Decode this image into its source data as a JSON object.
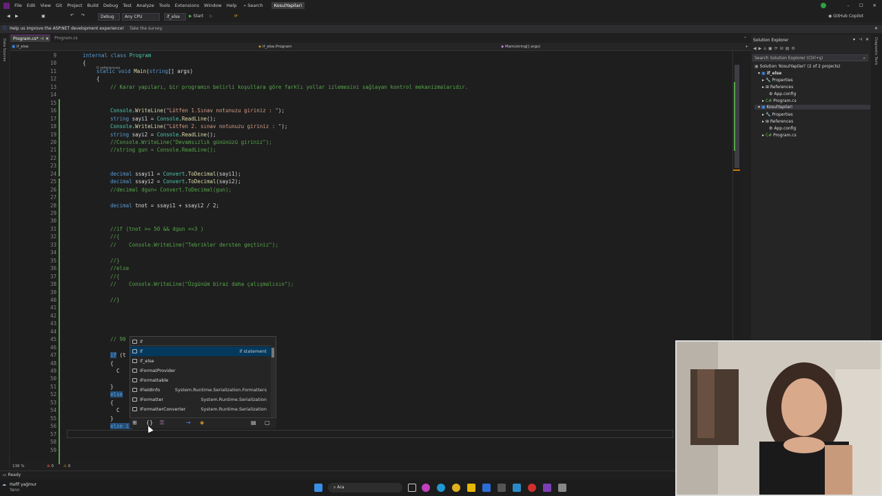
{
  "menu": {
    "items": [
      "File",
      "Edit",
      "View",
      "Git",
      "Project",
      "Build",
      "Debug",
      "Test",
      "Analyze",
      "Tools",
      "Extensions",
      "Window",
      "Help"
    ],
    "search_label": "Search",
    "solution_name": "KosulYapilari"
  },
  "toolbar": {
    "config": "Debug",
    "platform": "Any CPU",
    "project": "if_else",
    "start_label": "Start",
    "copilot_label": "GitHub Copilot"
  },
  "infobar": {
    "message": "Help us improve the ASP.NET development experience!",
    "link": "Take the survey."
  },
  "tabs": {
    "active": "Program.cs*",
    "inactive": "Program.cs",
    "project_dropdown": "if_else"
  },
  "navbar": {
    "class_path": "if_else.Program",
    "method_path": "Main(string[] args)"
  },
  "editor": {
    "references_hint": "0 references",
    "lines": [
      {
        "n": "9",
        "html": "<span class='kw'>internal class</span> <span class='typ'>Program</span>",
        "indent": 0
      },
      {
        "n": "10",
        "html": "<span class='plain'>{</span>",
        "indent": 0
      },
      {
        "n": "11",
        "html": "<span class='kw'>static void</span> <span class='mth'>Main</span><span class='plain'>(</span><span class='kw'>string</span><span class='plain'>[] args)</span>",
        "indent": 1
      },
      {
        "n": "12",
        "html": "<span class='plain'>{</span>",
        "indent": 1
      },
      {
        "n": "13",
        "html": "<span class='cmt'>// Karar yapıları, bir programın belirli koşullara göre farklı yollar izlemesini sağlayan kontrol mekanizmalarıdır.</span>",
        "indent": 2
      },
      {
        "n": "14",
        "html": "",
        "indent": 2
      },
      {
        "n": "15",
        "html": "",
        "indent": 2
      },
      {
        "n": "16",
        "html": "<span class='typ'>Console</span><span class='plain'>.</span><span class='mth'>WriteLine</span><span class='plain'>(</span><span class='str'>\"Lütfen 1.Sınav notunuzu giriniz : \"</span><span class='plain'>);</span>",
        "indent": 2
      },
      {
        "n": "17",
        "html": "<span class='kw'>string</span> <span class='plain'>sayi1 = </span><span class='typ'>Console</span><span class='plain'>.</span><span class='mth'>ReadLine</span><span class='plain'>();</span>",
        "indent": 2
      },
      {
        "n": "18",
        "html": "<span class='typ'>Console</span><span class='plain'>.</span><span class='mth'>WriteLine</span><span class='plain'>(</span><span class='str'>\"Lütfen 2. sınav notunuzu giriniz : \"</span><span class='plain'>);</span>",
        "indent": 2
      },
      {
        "n": "19",
        "html": "<span class='kw'>string</span> <span class='plain'>sayi2 = </span><span class='typ'>Console</span><span class='plain'>.</span><span class='mth'>ReadLine</span><span class='plain'>();</span>",
        "indent": 2
      },
      {
        "n": "20",
        "html": "<span class='cmt'>//Console.WriteLine(\"Devamsızlık gününüzü giriniz\");</span>",
        "indent": 2
      },
      {
        "n": "21",
        "html": "<span class='cmt'>//string gun = Console.ReadLine();</span>",
        "indent": 2
      },
      {
        "n": "22",
        "html": "",
        "indent": 2
      },
      {
        "n": "23",
        "html": "",
        "indent": 2
      },
      {
        "n": "24",
        "html": "<span class='kw'>decimal</span> <span class='plain'>ssayi1 = </span><span class='typ'>Convert</span><span class='plain'>.</span><span class='mth'>ToDecimal</span><span class='plain'>(sayi1);</span>",
        "indent": 2
      },
      {
        "n": "25",
        "html": "<span class='kw'>decimal</span> <span class='plain'>ssayi2 = </span><span class='typ'>Convert</span><span class='plain'>.</span><span class='mth'>ToDecimal</span><span class='plain'>(sayi2);</span>",
        "indent": 2
      },
      {
        "n": "26",
        "html": "<span class='cmt'>//decimal dgun= Convert.ToDecimal(gun);</span>",
        "indent": 2
      },
      {
        "n": "27",
        "html": "",
        "indent": 2
      },
      {
        "n": "28",
        "html": "<span class='kw'>decimal</span> <span class='plain'>tnot = ssayi1 + ssayi2 / 2;</span>",
        "indent": 2
      },
      {
        "n": "29",
        "html": "",
        "indent": 2
      },
      {
        "n": "30",
        "html": "",
        "indent": 2
      },
      {
        "n": "31",
        "html": "<span class='cmt'>//if (tnot &gt;= 50 &amp;&amp; dgun &lt;=3 )</span>",
        "indent": 2
      },
      {
        "n": "32",
        "html": "<span class='cmt'>//{</span>",
        "indent": 2
      },
      {
        "n": "33",
        "html": "<span class='cmt'>//    Console.WriteLine(\"Tebrikler dersten geçtiniz\");</span>",
        "indent": 2
      },
      {
        "n": "34",
        "html": "",
        "indent": 2
      },
      {
        "n": "35",
        "html": "<span class='cmt'>//}</span>",
        "indent": 2
      },
      {
        "n": "36",
        "html": "<span class='cmt'>//else</span>",
        "indent": 2
      },
      {
        "n": "37",
        "html": "<span class='cmt'>//{</span>",
        "indent": 2
      },
      {
        "n": "38",
        "html": "<span class='cmt'>//    Console.WriteLine(\"Üzgünüm biraz daha çalışmalısın\");</span>",
        "indent": 2
      },
      {
        "n": "39",
        "html": "",
        "indent": 2
      },
      {
        "n": "40",
        "html": "<span class='cmt'>//}</span>",
        "indent": 2
      },
      {
        "n": "41",
        "html": "",
        "indent": 2
      },
      {
        "n": "42",
        "html": "",
        "indent": 2
      },
      {
        "n": "43",
        "html": "",
        "indent": 2
      },
      {
        "n": "44",
        "html": "",
        "indent": 2
      },
      {
        "n": "45",
        "html": "<span class='cmt'>// 90</span>",
        "indent": 2
      },
      {
        "n": "46",
        "html": "",
        "indent": 2
      },
      {
        "n": "47",
        "html": "<span class='kw'>if</span> <span class='plain'>(t</span>",
        "indent": 2
      },
      {
        "n": "48",
        "html": "<span class='plain'>{</span>",
        "indent": 2
      },
      {
        "n": "49",
        "html": "<span class='plain'>  C</span><span class='str' style='margin-left:200px'>z\"</span><span class='plain'>);</span>",
        "indent": 2
      },
      {
        "n": "50",
        "html": "",
        "indent": 2
      },
      {
        "n": "51",
        "html": "<span class='plain'>}</span>",
        "indent": 2
      },
      {
        "n": "52",
        "html": "<span class='kw'>else</span>",
        "indent": 2
      },
      {
        "n": "53",
        "html": "<span class='plain'>{</span>",
        "indent": 2
      },
      {
        "n": "54",
        "html": "<span class='plain'>  C</span><span class='plain' style='margin-left:210px'>\");</span>",
        "indent": 2
      },
      {
        "n": "55",
        "html": "<span class='plain'>}</span>",
        "indent": 2
      },
      {
        "n": "56",
        "html": "<span class='kw'>else if</span><span class='hint'> (tnot &gt;=</span>",
        "indent": 2
      },
      {
        "n": "57",
        "html": "",
        "indent": 2
      },
      {
        "n": "58",
        "html": "",
        "indent": 2
      },
      {
        "n": "59",
        "html": "",
        "indent": 2
      }
    ]
  },
  "completion": {
    "typed": "if",
    "items": [
      {
        "name": "if",
        "desc": "if statement"
      },
      {
        "name": "if_else",
        "desc": ""
      },
      {
        "name": "IFormatProvider",
        "desc": ""
      },
      {
        "name": "IFormattable",
        "desc": ""
      },
      {
        "name": "IFieldInfo",
        "desc": "System.Runtime.Serialization.Formatters"
      },
      {
        "name": "IFormatter",
        "desc": "System.Runtime.Serialization"
      },
      {
        "name": "IFormatterConverter",
        "desc": "System.Runtime.Serialization"
      }
    ]
  },
  "solution_explorer": {
    "title": "Solution Explorer",
    "search_placeholder": "Search Solution Explorer (Ctrl+ş)",
    "solution": "Solution 'KosulYapilari' (2 of 2 projects)",
    "project1": "if_else",
    "project1_items": [
      "Properties",
      "References",
      "App.config",
      "Program.cs"
    ],
    "project2": "KosulYapilari",
    "project2_items": [
      "Properties",
      "References",
      "App.config",
      "Program.cs"
    ]
  },
  "statusbar": {
    "zoom": "136 %",
    "errors": "0",
    "warnings": "0",
    "ready": "Ready"
  },
  "taskbar": {
    "weather_line1": "Hafif yağmur",
    "weather_line2": "Yarın",
    "search_label": "Ara"
  },
  "colors": {
    "accent": "#0e639c",
    "vs_purple": "#68217a",
    "comment": "#57a64a",
    "keyword": "#569cd6",
    "string": "#d69d85"
  }
}
